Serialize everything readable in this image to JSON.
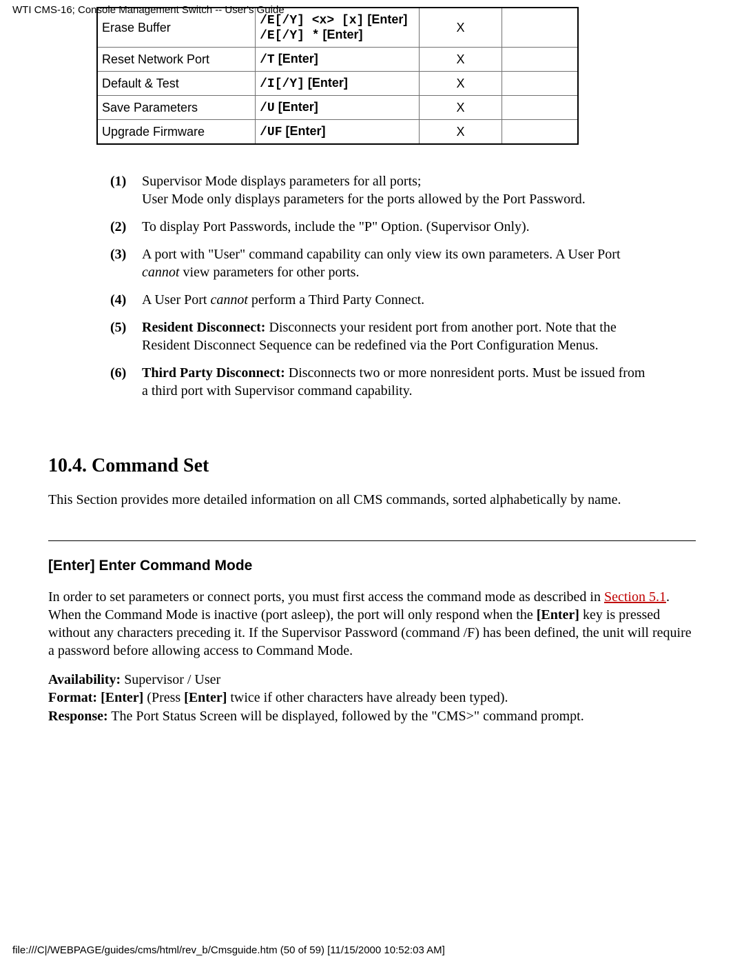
{
  "header": "WTI CMS-16; Console Management Switch -- User's Guide",
  "footer": "file:///C|/WEBPAGE/guides/cms/html/rev_b/Cmsguide.htm (50 of 59) [11/15/2000 10:52:03 AM]",
  "table": {
    "rows": [
      {
        "name": "Erase Buffer",
        "cmd_line1_mono": "/E[/Y] <x> [x]",
        "cmd_line1_sans": " [Enter]",
        "cmd_line2_mono": "/E[/Y] *",
        "cmd_line2_sans": " [Enter]",
        "x": "X",
        "e": ""
      },
      {
        "name": "Reset Network Port",
        "cmd_mono": "/T",
        "cmd_sans": " [Enter]",
        "x": "X",
        "e": ""
      },
      {
        "name": "Default & Test",
        "cmd_mono": "/I[/Y]",
        "cmd_sans": " [Enter]",
        "x": "X",
        "e": ""
      },
      {
        "name": "Save Parameters",
        "cmd_mono": "/U",
        "cmd_sans": " [Enter]",
        "x": "X",
        "e": ""
      },
      {
        "name": "Upgrade Firmware",
        "cmd_mono": "/UF",
        "cmd_sans": " [Enter]",
        "x": "X",
        "e": ""
      }
    ]
  },
  "notes": [
    {
      "num": "(1)",
      "text": "Supervisor Mode displays parameters for all ports;\nUser Mode only displays parameters for the ports allowed by the Port Password."
    },
    {
      "num": "(2)",
      "text": "To display Port Passwords, include the \"P\" Option. (Supervisor Only)."
    },
    {
      "num": "(3)",
      "pre": "A port with \"User\" command capability can only view its own parameters. A User Port ",
      "em": "cannot",
      "post": " view parameters for other ports."
    },
    {
      "num": "(4)",
      "pre": "A User Port ",
      "em": "cannot",
      "post": " perform a Third Party Connect."
    },
    {
      "num": "(5)",
      "lead": "Resident Disconnect:",
      "text": "  Disconnects your resident port from another port.  Note that the Resident Disconnect Sequence can be redefined via the Port Configuration Menus."
    },
    {
      "num": "(6)",
      "lead": "Third Party Disconnect:",
      "text": "  Disconnects two or more nonresident ports.  Must be issued from a third port with Supervisor command capability."
    }
  ],
  "section": {
    "title": "10.4.   Command Set",
    "intro": "This Section provides more detailed information on all CMS commands, sorted alphabetically by name."
  },
  "cmd_detail": {
    "heading": "[Enter]   Enter Command Mode",
    "p1_pre": "In order to set parameters or connect ports, you must first access the command mode as described in ",
    "p1_link": "Section 5.1",
    "p1_post": ". When the Command Mode is inactive (port asleep), the port will only respond when the ",
    "p1_bold": "[Enter]",
    "p1_post2": " key is pressed without any characters preceding it. If the Supervisor Password (command /F) has been defined, the unit will require a password before allowing access to Command Mode.",
    "avail_label": "Availability:",
    "avail_text": "  Supervisor / User",
    "fmt_label": "Format:",
    "fmt_bold1": "  [Enter]",
    "fmt_mid": " (Press ",
    "fmt_bold2": "[Enter]",
    "fmt_post": " twice if other characters have already been typed).",
    "resp_label": "Response:",
    "resp_text": "  The Port Status Screen will be displayed, followed by the \"CMS>\" command prompt."
  }
}
